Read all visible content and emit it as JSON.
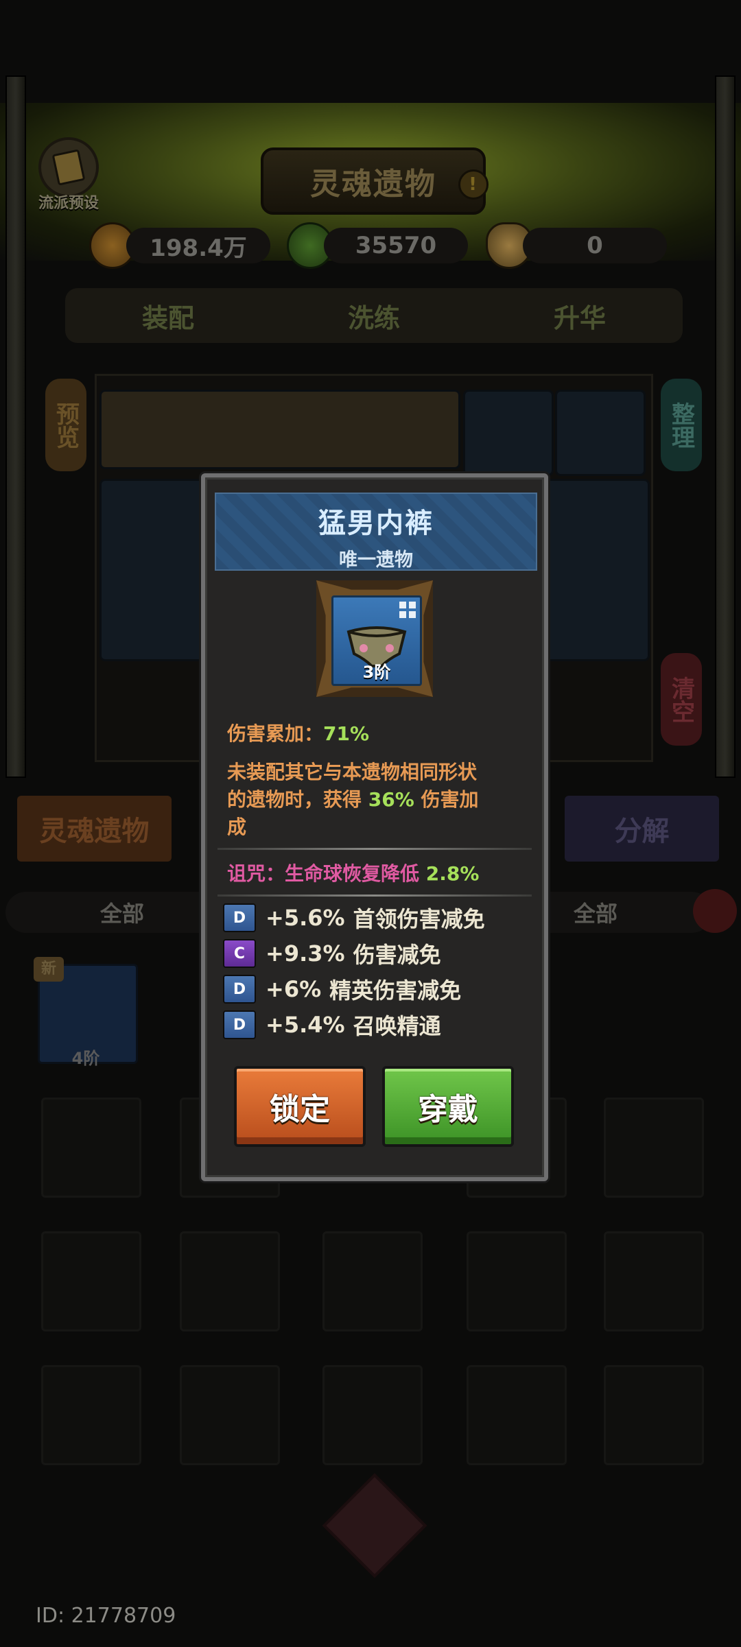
{
  "header": {
    "preset_label": "流派预设",
    "title": "灵魂遗物",
    "info_icon": "info-icon"
  },
  "currencies": [
    {
      "icon": "coin-icon",
      "value": "198.4万",
      "color": "#b07a30"
    },
    {
      "icon": "soul-slime-icon",
      "value": "35570",
      "color": "#5a8a34"
    },
    {
      "icon": "tooth-icon",
      "value": "0",
      "color": "#c8a060"
    }
  ],
  "tabs": [
    "装配",
    "洗练",
    "升华"
  ],
  "side": {
    "preview": "预览",
    "sort": "整理",
    "clear": "清空"
  },
  "actions": {
    "soul_relic": "灵魂遗物",
    "decompose": "分解"
  },
  "filters": {
    "left": "全部",
    "right": "全部"
  },
  "inventory": [
    {
      "new_badge": "新",
      "tier": "4阶"
    }
  ],
  "footer": {
    "id_text": "ID: 21778709"
  },
  "popup": {
    "title": "猛男内裤",
    "subtitle": "唯一遗物",
    "item_tier": "3阶",
    "damage_stack_label": "伤害累加：",
    "damage_stack_value": "71%",
    "desc_line1": "未装配其它与本遗物相同形状",
    "desc_line2_pre": "的遗物时，获得 ",
    "desc_line2_value": "36%",
    "desc_line2_post": " 伤害加",
    "desc_line3": "成",
    "curse_label": "诅咒：生命球恢复降低 ",
    "curse_value": "2.8%",
    "attributes": [
      {
        "grade": "D",
        "value": "+5.6%",
        "name": "首领伤害减免"
      },
      {
        "grade": "C",
        "value": "+9.3%",
        "name": "伤害减免"
      },
      {
        "grade": "D",
        "value": "+6%",
        "name": "精英伤害减免"
      },
      {
        "grade": "D",
        "value": "+5.4%",
        "name": "召唤精通"
      }
    ],
    "lock_label": "锁定",
    "equip_label": "穿戴"
  }
}
